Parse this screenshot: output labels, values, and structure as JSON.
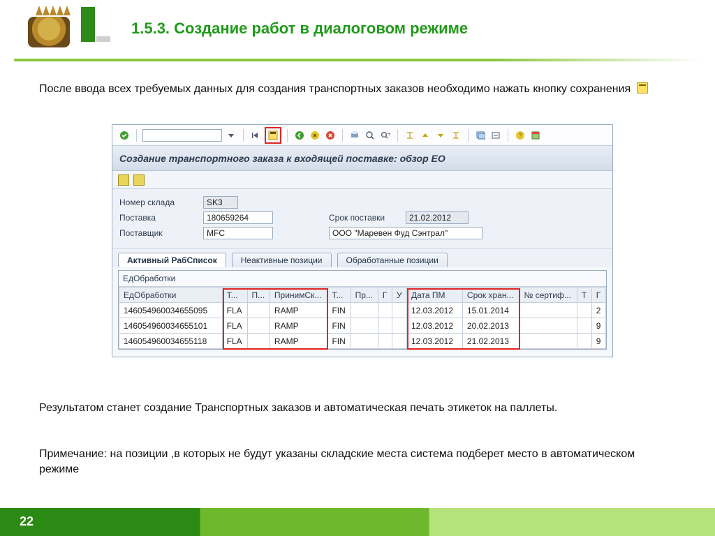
{
  "doc": {
    "title": "1.5.3. Создание работ в диалоговом режиме",
    "intro": "После ввода всех требуемых данных для создания транспортных заказов необходимо нажать кнопку сохранения",
    "result": "Результатом станет создание Транспортных заказов и автоматическая печать этикеток на паллеты.",
    "note": "Примечание: на позиции ,в которых не будут указаны складские места система подберет место в автоматическом режиме",
    "page": "22"
  },
  "sap": {
    "title": "Создание транспортного заказа к входящей поставке: обзор ЕО",
    "form": {
      "warehouse_label": "Номер склада",
      "warehouse_value": "SK3",
      "delivery_label": "Поставка",
      "delivery_value": "180659264",
      "delivery_date_label": "Срок поставки",
      "delivery_date_value": "21.02.2012",
      "vendor_label": "Поставщик",
      "vendor_value": "MFC",
      "vendor_name": "ООО \"Маревен Фуд Сэнтрал\""
    },
    "tabs": {
      "t1": "Активный РабСписок",
      "t2": "Неактивные позиции",
      "t3": "Обработанные позиции"
    },
    "grid": {
      "title": "ЕдОбработки",
      "cols": {
        "c1": "ЕдОбработки",
        "c2": "Т...",
        "c3": "П...",
        "c4": "ПринимСк...",
        "c5": "Т...",
        "c6": "Пр...",
        "c7": "Г",
        "c8": "У",
        "c9": "Дата ПМ",
        "c10": "Срок хран...",
        "c11": "№ сертиф...",
        "c12": "Т",
        "c13": "Г"
      },
      "rows": [
        {
          "id": "146054960034655095",
          "t": "FLA",
          "p": "",
          "sk": "RAMP",
          "t2": "FIN",
          "pr": "",
          "g": "",
          "u": "",
          "pm": "12.03.2012",
          "exp": "15.01.2014",
          "cert": "",
          "tt": "",
          "g2": "2"
        },
        {
          "id": "146054960034655101",
          "t": "FLA",
          "p": "",
          "sk": "RAMP",
          "t2": "FIN",
          "pr": "",
          "g": "",
          "u": "",
          "pm": "12.03.2012",
          "exp": "20.02.2013",
          "cert": "",
          "tt": "",
          "g2": "9"
        },
        {
          "id": "146054960034655118",
          "t": "FLA",
          "p": "",
          "sk": "RAMP",
          "t2": "FIN",
          "pr": "",
          "g": "",
          "u": "",
          "pm": "12.03.2012",
          "exp": "21.02.2013",
          "cert": "",
          "tt": "",
          "g2": "9"
        }
      ]
    }
  }
}
